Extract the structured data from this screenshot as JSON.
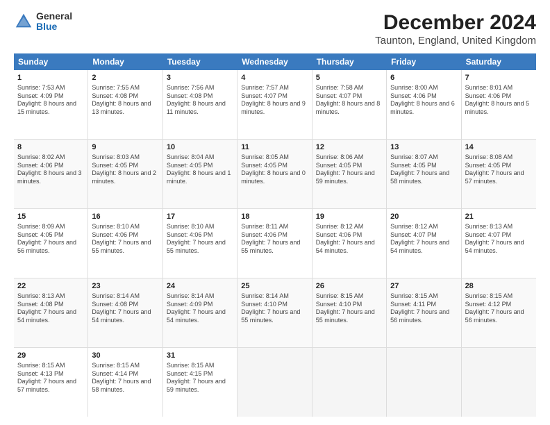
{
  "logo": {
    "general": "General",
    "blue": "Blue"
  },
  "title": "December 2024",
  "subtitle": "Taunton, England, United Kingdom",
  "header_days": [
    "Sunday",
    "Monday",
    "Tuesday",
    "Wednesday",
    "Thursday",
    "Friday",
    "Saturday"
  ],
  "weeks": [
    [
      {
        "day": "1",
        "rise": "Sunrise: 7:53 AM",
        "set": "Sunset: 4:09 PM",
        "daylight": "Daylight: 8 hours and 15 minutes."
      },
      {
        "day": "2",
        "rise": "Sunrise: 7:55 AM",
        "set": "Sunset: 4:08 PM",
        "daylight": "Daylight: 8 hours and 13 minutes."
      },
      {
        "day": "3",
        "rise": "Sunrise: 7:56 AM",
        "set": "Sunset: 4:08 PM",
        "daylight": "Daylight: 8 hours and 11 minutes."
      },
      {
        "day": "4",
        "rise": "Sunrise: 7:57 AM",
        "set": "Sunset: 4:07 PM",
        "daylight": "Daylight: 8 hours and 9 minutes."
      },
      {
        "day": "5",
        "rise": "Sunrise: 7:58 AM",
        "set": "Sunset: 4:07 PM",
        "daylight": "Daylight: 8 hours and 8 minutes."
      },
      {
        "day": "6",
        "rise": "Sunrise: 8:00 AM",
        "set": "Sunset: 4:06 PM",
        "daylight": "Daylight: 8 hours and 6 minutes."
      },
      {
        "day": "7",
        "rise": "Sunrise: 8:01 AM",
        "set": "Sunset: 4:06 PM",
        "daylight": "Daylight: 8 hours and 5 minutes."
      }
    ],
    [
      {
        "day": "8",
        "rise": "Sunrise: 8:02 AM",
        "set": "Sunset: 4:06 PM",
        "daylight": "Daylight: 8 hours and 3 minutes."
      },
      {
        "day": "9",
        "rise": "Sunrise: 8:03 AM",
        "set": "Sunset: 4:05 PM",
        "daylight": "Daylight: 8 hours and 2 minutes."
      },
      {
        "day": "10",
        "rise": "Sunrise: 8:04 AM",
        "set": "Sunset: 4:05 PM",
        "daylight": "Daylight: 8 hours and 1 minute."
      },
      {
        "day": "11",
        "rise": "Sunrise: 8:05 AM",
        "set": "Sunset: 4:05 PM",
        "daylight": "Daylight: 8 hours and 0 minutes."
      },
      {
        "day": "12",
        "rise": "Sunrise: 8:06 AM",
        "set": "Sunset: 4:05 PM",
        "daylight": "Daylight: 7 hours and 59 minutes."
      },
      {
        "day": "13",
        "rise": "Sunrise: 8:07 AM",
        "set": "Sunset: 4:05 PM",
        "daylight": "Daylight: 7 hours and 58 minutes."
      },
      {
        "day": "14",
        "rise": "Sunrise: 8:08 AM",
        "set": "Sunset: 4:05 PM",
        "daylight": "Daylight: 7 hours and 57 minutes."
      }
    ],
    [
      {
        "day": "15",
        "rise": "Sunrise: 8:09 AM",
        "set": "Sunset: 4:05 PM",
        "daylight": "Daylight: 7 hours and 56 minutes."
      },
      {
        "day": "16",
        "rise": "Sunrise: 8:10 AM",
        "set": "Sunset: 4:06 PM",
        "daylight": "Daylight: 7 hours and 55 minutes."
      },
      {
        "day": "17",
        "rise": "Sunrise: 8:10 AM",
        "set": "Sunset: 4:06 PM",
        "daylight": "Daylight: 7 hours and 55 minutes."
      },
      {
        "day": "18",
        "rise": "Sunrise: 8:11 AM",
        "set": "Sunset: 4:06 PM",
        "daylight": "Daylight: 7 hours and 55 minutes."
      },
      {
        "day": "19",
        "rise": "Sunrise: 8:12 AM",
        "set": "Sunset: 4:06 PM",
        "daylight": "Daylight: 7 hours and 54 minutes."
      },
      {
        "day": "20",
        "rise": "Sunrise: 8:12 AM",
        "set": "Sunset: 4:07 PM",
        "daylight": "Daylight: 7 hours and 54 minutes."
      },
      {
        "day": "21",
        "rise": "Sunrise: 8:13 AM",
        "set": "Sunset: 4:07 PM",
        "daylight": "Daylight: 7 hours and 54 minutes."
      }
    ],
    [
      {
        "day": "22",
        "rise": "Sunrise: 8:13 AM",
        "set": "Sunset: 4:08 PM",
        "daylight": "Daylight: 7 hours and 54 minutes."
      },
      {
        "day": "23",
        "rise": "Sunrise: 8:14 AM",
        "set": "Sunset: 4:08 PM",
        "daylight": "Daylight: 7 hours and 54 minutes."
      },
      {
        "day": "24",
        "rise": "Sunrise: 8:14 AM",
        "set": "Sunset: 4:09 PM",
        "daylight": "Daylight: 7 hours and 54 minutes."
      },
      {
        "day": "25",
        "rise": "Sunrise: 8:14 AM",
        "set": "Sunset: 4:10 PM",
        "daylight": "Daylight: 7 hours and 55 minutes."
      },
      {
        "day": "26",
        "rise": "Sunrise: 8:15 AM",
        "set": "Sunset: 4:10 PM",
        "daylight": "Daylight: 7 hours and 55 minutes."
      },
      {
        "day": "27",
        "rise": "Sunrise: 8:15 AM",
        "set": "Sunset: 4:11 PM",
        "daylight": "Daylight: 7 hours and 56 minutes."
      },
      {
        "day": "28",
        "rise": "Sunrise: 8:15 AM",
        "set": "Sunset: 4:12 PM",
        "daylight": "Daylight: 7 hours and 56 minutes."
      }
    ],
    [
      {
        "day": "29",
        "rise": "Sunrise: 8:15 AM",
        "set": "Sunset: 4:13 PM",
        "daylight": "Daylight: 7 hours and 57 minutes."
      },
      {
        "day": "30",
        "rise": "Sunrise: 8:15 AM",
        "set": "Sunset: 4:14 PM",
        "daylight": "Daylight: 7 hours and 58 minutes."
      },
      {
        "day": "31",
        "rise": "Sunrise: 8:15 AM",
        "set": "Sunset: 4:15 PM",
        "daylight": "Daylight: 7 hours and 59 minutes."
      },
      null,
      null,
      null,
      null
    ]
  ]
}
